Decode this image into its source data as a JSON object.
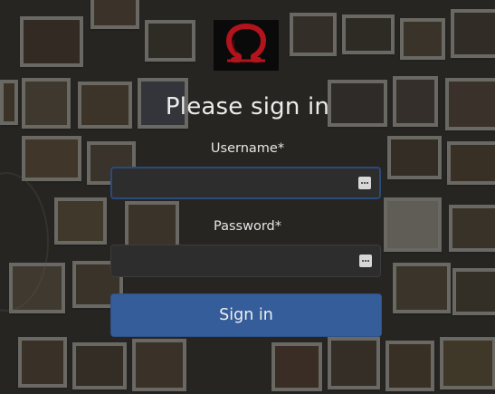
{
  "logo": {
    "icon": "omega-logo-icon",
    "color": "#b3131b"
  },
  "form": {
    "title": "Please sign in",
    "username_label": "Username*",
    "username_value": "",
    "password_label": "Password*",
    "password_value": "",
    "password_manager_icon": "password-manager-icon",
    "submit_label": "Sign in"
  },
  "colors": {
    "button": "#345d9a",
    "field_background": "#2d2d2d",
    "focus_border": "#2a4a7a"
  }
}
